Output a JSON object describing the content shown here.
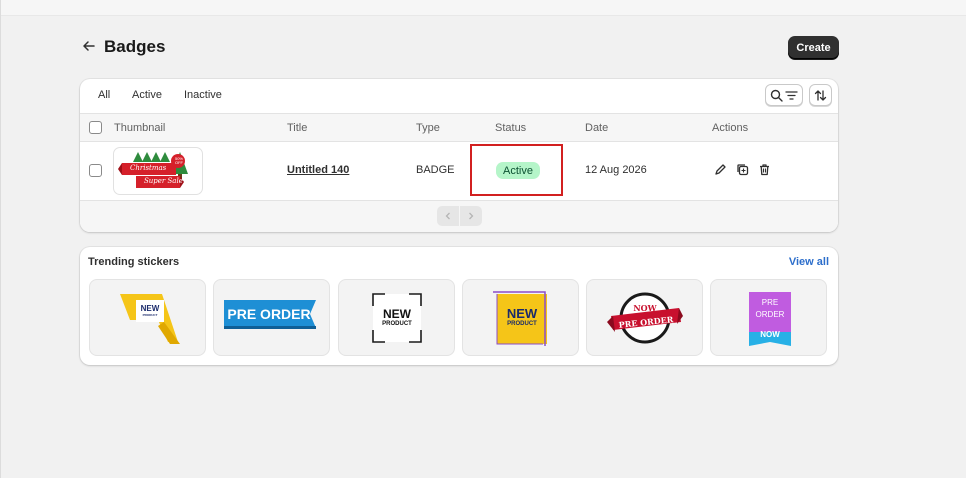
{
  "page": {
    "title": "Badges",
    "create_label": "Create"
  },
  "filters": {
    "tabs": [
      "All",
      "Active",
      "Inactive"
    ]
  },
  "table": {
    "columns": [
      "Thumbnail",
      "Title",
      "Type",
      "Status",
      "Date",
      "Actions"
    ],
    "rows": [
      {
        "thumbnail_text_1": "Christmas",
        "thumbnail_text_2": "Super Sale",
        "thumbnail_badge": "50% OFF",
        "title": "Untitled 140",
        "type": "BADGE",
        "status": "Active",
        "date": "12 Aug 2026"
      }
    ]
  },
  "trending": {
    "title": "Trending stickers",
    "view_all": "View all",
    "stickers": [
      {
        "line1": "NEW",
        "line2": "PRODUCT"
      },
      {
        "line1": "PRE ORDER"
      },
      {
        "line1": "NEW",
        "line2": "PRODUCT"
      },
      {
        "line1": "NEW",
        "line2": "PRODUCT"
      },
      {
        "line1": "NOW",
        "line2": "PRE ORDER"
      },
      {
        "line1": "PRE",
        "line2": "ORDER",
        "line3": "NOW"
      }
    ]
  },
  "icons": [
    "back-arrow-icon",
    "search-icon",
    "filter-icon",
    "sort-icon",
    "edit-icon",
    "duplicate-icon",
    "delete-icon",
    "chevron-left-icon",
    "chevron-right-icon"
  ],
  "colors": {
    "primary_button": "#303030",
    "status_active_bg": "#b5f5c9",
    "status_active_text": "#0c5132",
    "link": "#2c6ecb",
    "highlight": "#d22020"
  }
}
